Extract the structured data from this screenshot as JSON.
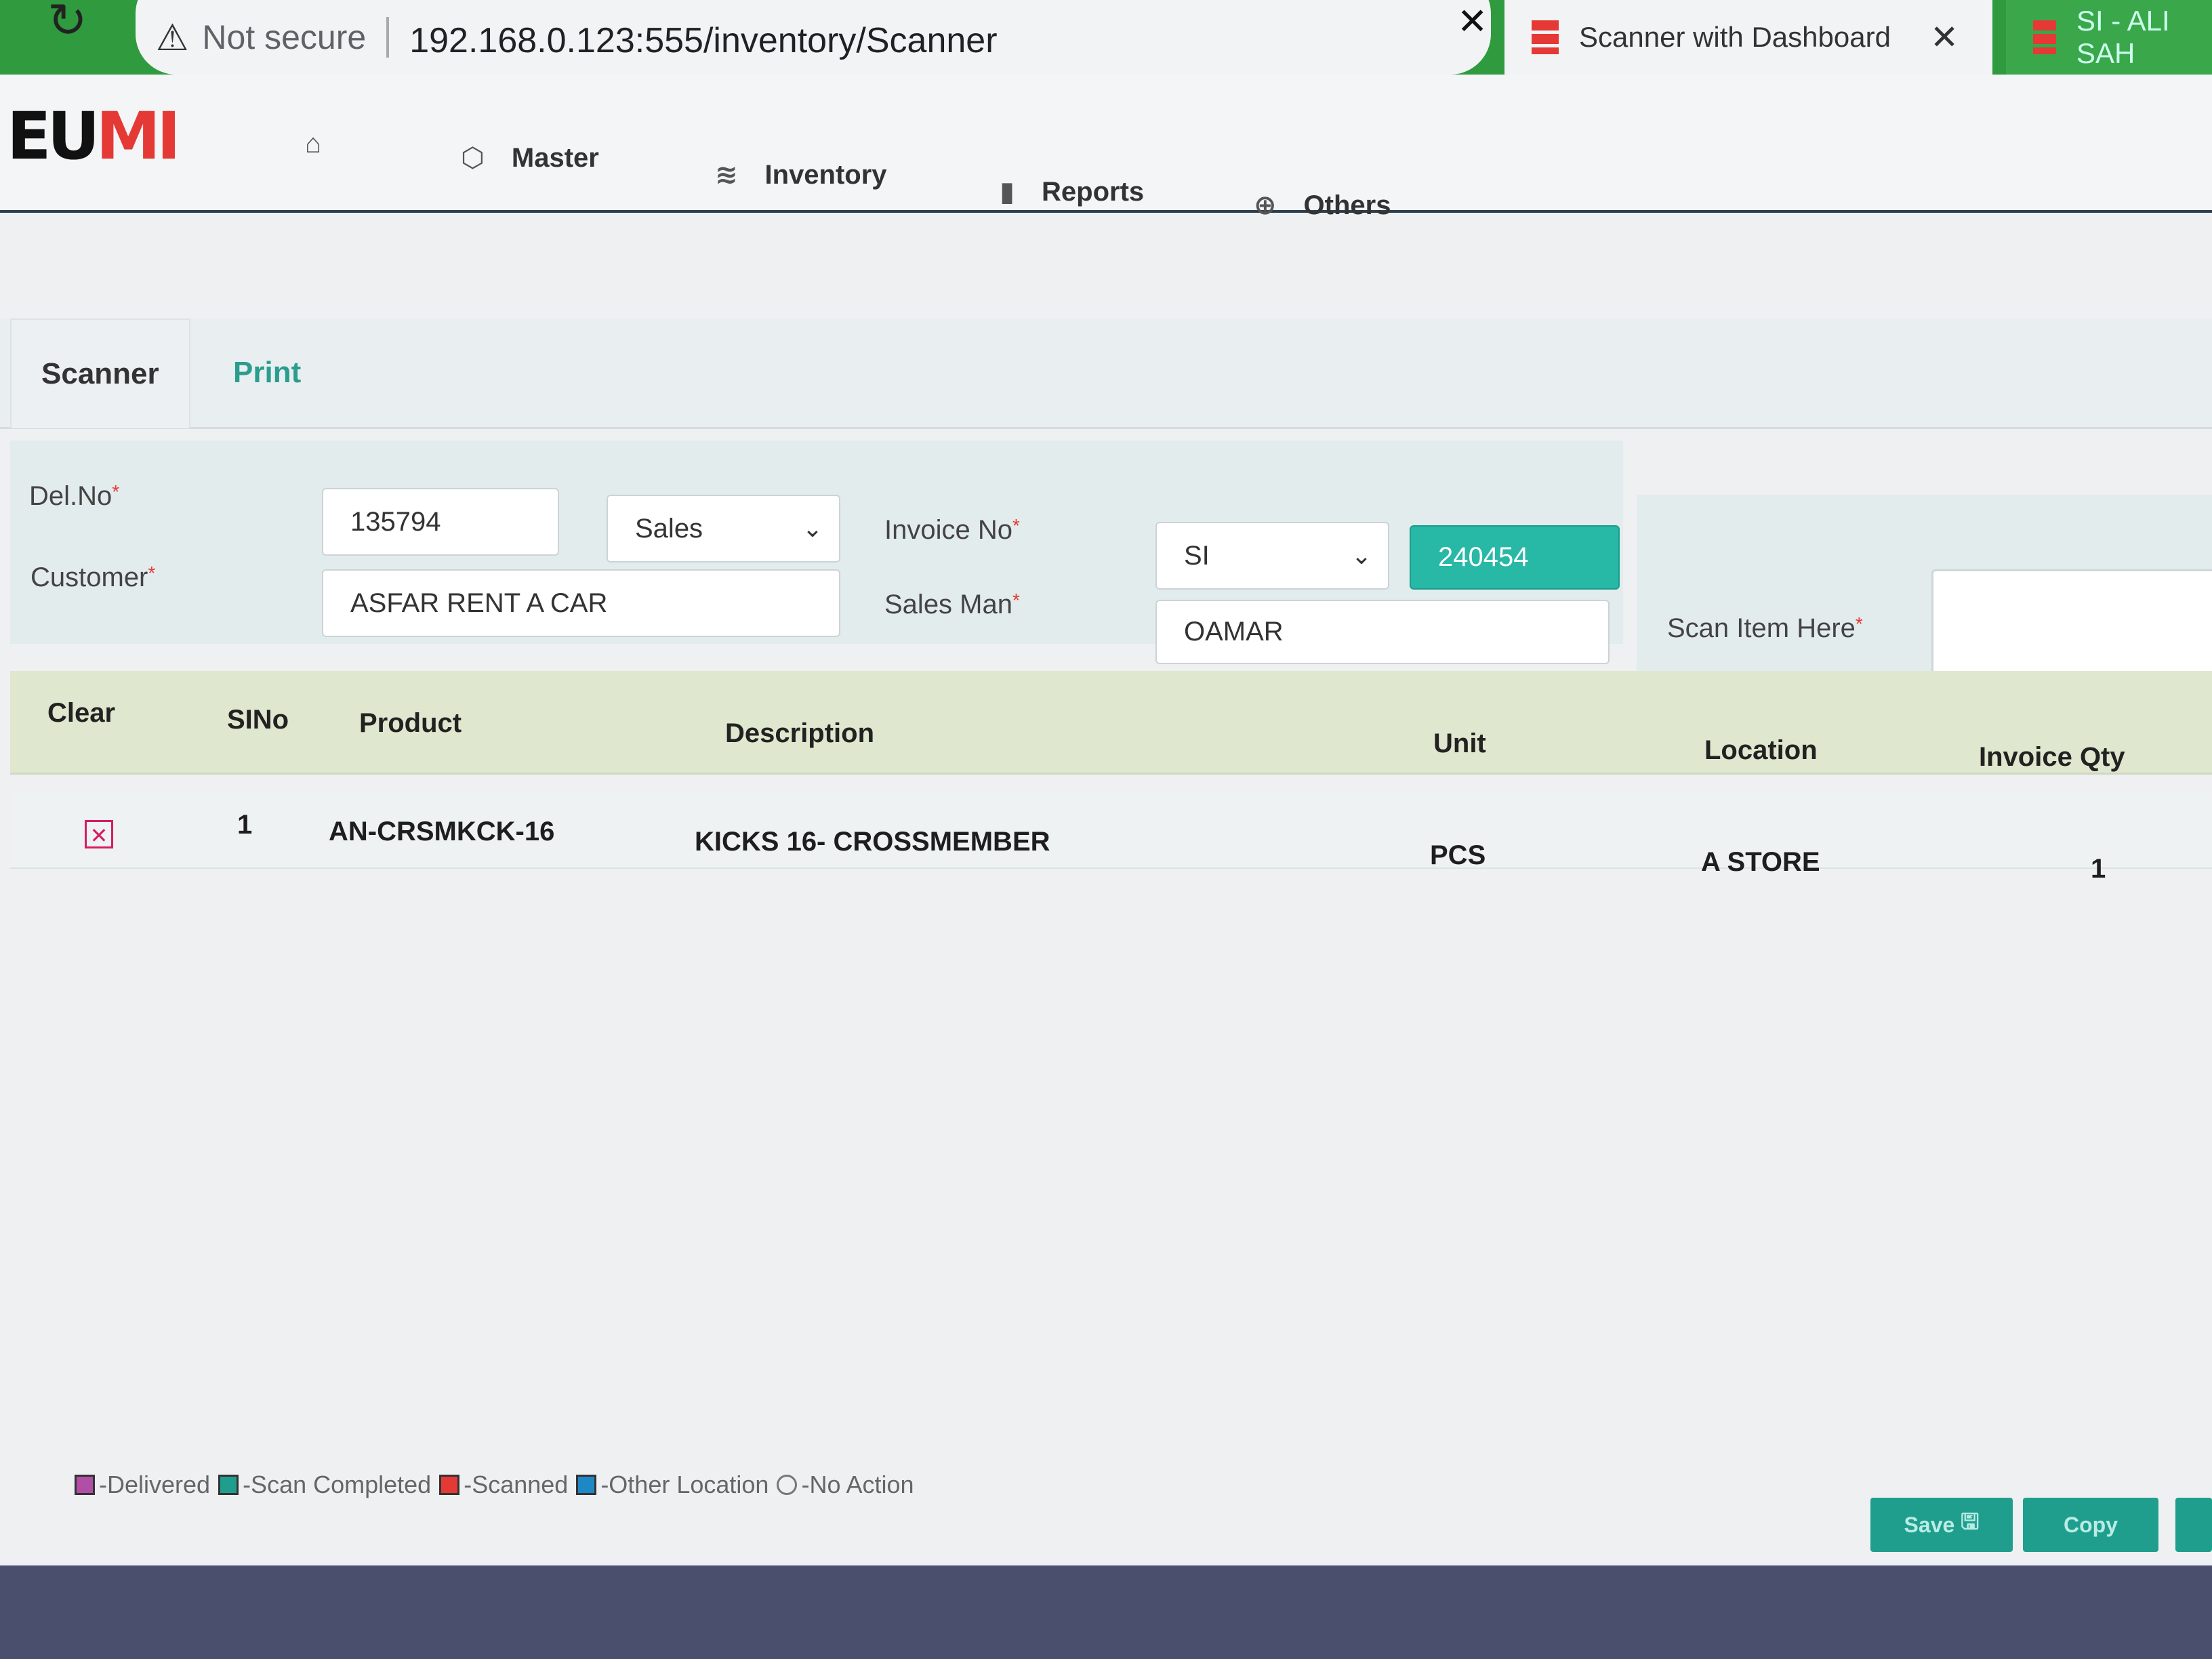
{
  "browser": {
    "reload_icon": "reload-icon",
    "security_label": "Not secure",
    "url": "192.168.0.123:555/inventory/Scanner",
    "tabs": [
      {
        "title": "Scanner with Dashboard"
      },
      {
        "title": "SI - ALI SAH"
      }
    ]
  },
  "nav": {
    "logo_a": "EU",
    "logo_b": "MI",
    "items": [
      {
        "label": "Master"
      },
      {
        "label": "Inventory"
      },
      {
        "label": "Reports"
      },
      {
        "label": "Others"
      }
    ]
  },
  "page_tabs": {
    "scanner": "Scanner",
    "print": "Print"
  },
  "form": {
    "del_no_label": "Del.No",
    "del_no_value": "135794",
    "type_value": "Sales",
    "customer_label": "Customer",
    "customer_value": "ASFAR RENT A CAR",
    "invoice_label": "Invoice No",
    "invoice_prefix": "SI",
    "invoice_value": "240454",
    "salesman_label": "Sales Man",
    "salesman_value": "OAMAR",
    "scan_label": "Scan Item Here",
    "required_mark": "*"
  },
  "table": {
    "headers": {
      "clear": "Clear",
      "sino": "SINo",
      "product": "Product",
      "description": "Description",
      "unit": "Unit",
      "location": "Location",
      "invoice_qty": "Invoice Qty"
    },
    "rows": [
      {
        "sino": "1",
        "product": "AN-CRSMKCK-16",
        "description": "KICKS 16- CROSSMEMBER",
        "unit": "PCS",
        "location": "A STORE",
        "invoice_qty": "1"
      }
    ]
  },
  "legend": {
    "delivered": "-Delivered",
    "scan_completed": "-Scan Completed",
    "scanned": "-Scanned",
    "other_location": "-Other Location",
    "no_action": "-No Action",
    "colors": {
      "delivered": "#b04fa5",
      "scan_completed": "#1f9e8e",
      "scanned": "#e53935",
      "other_location": "#1e88c7"
    }
  },
  "buttons": {
    "save": "Save",
    "copy": "Copy"
  },
  "colors": {
    "accent": "#27b8a6",
    "brand_red": "#e53935",
    "browser_green": "#2f9a3e"
  }
}
